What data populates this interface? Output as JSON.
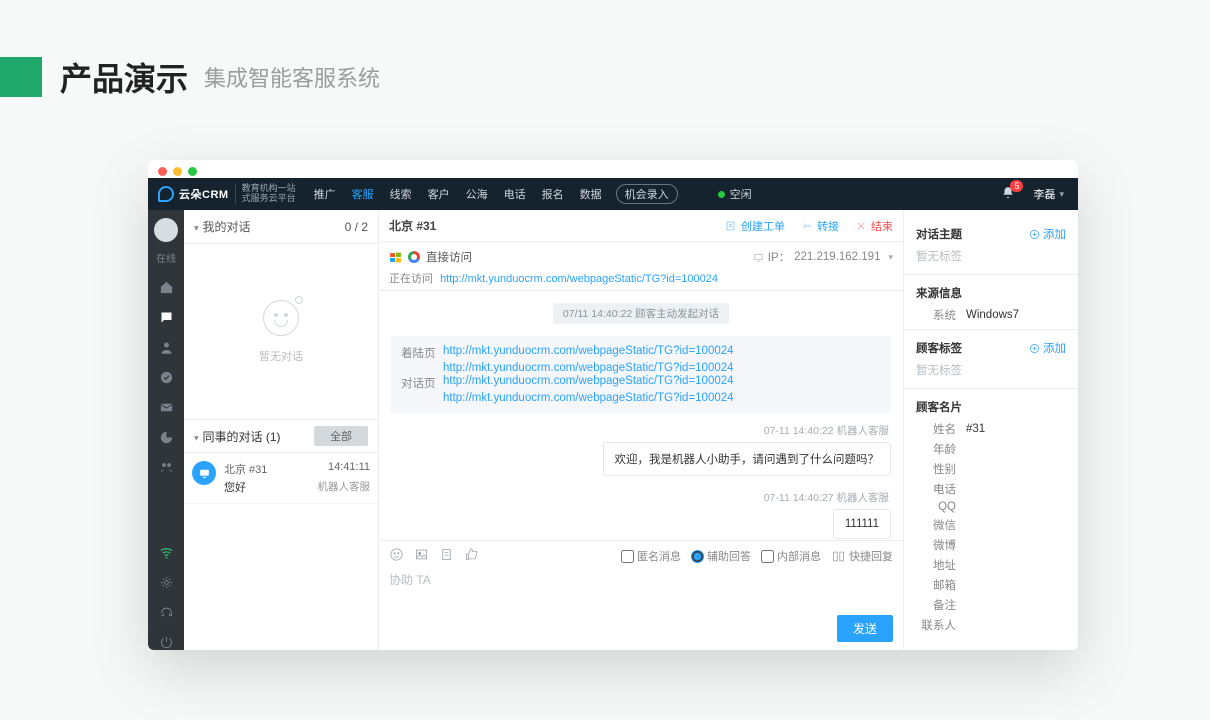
{
  "slide": {
    "title": "产品演示",
    "subtitle": "集成智能客服系统"
  },
  "topnav": {
    "brand": "云朵CRM",
    "sub1": "教育机构一站",
    "sub2": "式服务云平台",
    "items": [
      "推广",
      "客服",
      "线索",
      "客户",
      "公海",
      "电话",
      "报名",
      "数据"
    ],
    "active_index": 1,
    "button": "机会录入",
    "status": "空闲",
    "notifications": "5",
    "username": "李磊"
  },
  "rail": {
    "status": "在线"
  },
  "conversations": {
    "my_label": "我的对话",
    "count": "0 / 2",
    "empty": "暂无对话",
    "peer_label": "同事的对话  (1)",
    "all_label": "全部",
    "item": {
      "title": "北京 #31",
      "time": "14:41:11",
      "msg": "您好",
      "agent": "机器人客服"
    }
  },
  "chat": {
    "title": "北京 #31",
    "actions": {
      "create": "创建工单",
      "transfer": "转接",
      "end": "结束"
    },
    "visit": {
      "direct": "直接访问",
      "visiting_label": "正在访问",
      "url": "http://mkt.yunduocrm.com/webpageStatic/TG?id=100024"
    },
    "ip": {
      "label": "IP：",
      "value": "221.219.162.191"
    },
    "datepill": "07/11 14:40:22   顾客主动发起对话",
    "info_labels": {
      "landing": "着陆页",
      "chat": "对话页"
    },
    "info_urls": [
      "http://mkt.yunduocrm.com/webpageStatic/TG?id=100024",
      "http://mkt.yunduocrm.com/webpageStatic/TG?id=100024",
      "http://mkt.yunduocrm.com/webpageStatic/TG?id=100024",
      "http://mkt.yunduocrm.com/webpageStatic/TG?id=100024"
    ],
    "ts1": "07-11 14:40:22   机器人客服",
    "bubble1": "欢迎，我是机器人小助手，请问遇到了什么问题吗？",
    "ts2": "07-11 14:40:27   机器人客服",
    "bubble2": "111111",
    "tool_opts": {
      "anon": "匿名消息",
      "assist": "辅助回答",
      "internal": "内部消息",
      "quick": "快捷回复"
    },
    "placeholder": "协助 TA",
    "send": "发送"
  },
  "right": {
    "topic": "对话主题",
    "add": "添加",
    "no_tag": "暂无标签",
    "source": "来源信息",
    "system_k": "系统",
    "system_v": "Windows7",
    "tags": "顾客标签",
    "card": "顾客名片",
    "fields": {
      "name_k": "姓名",
      "name_v": "#31",
      "age": "年龄",
      "gender": "性别",
      "phone": "电话",
      "qq": "QQ",
      "wechat": "微信",
      "weibo": "微博",
      "addr": "地址",
      "email": "邮箱",
      "remark": "备注",
      "contact": "联系人"
    }
  }
}
